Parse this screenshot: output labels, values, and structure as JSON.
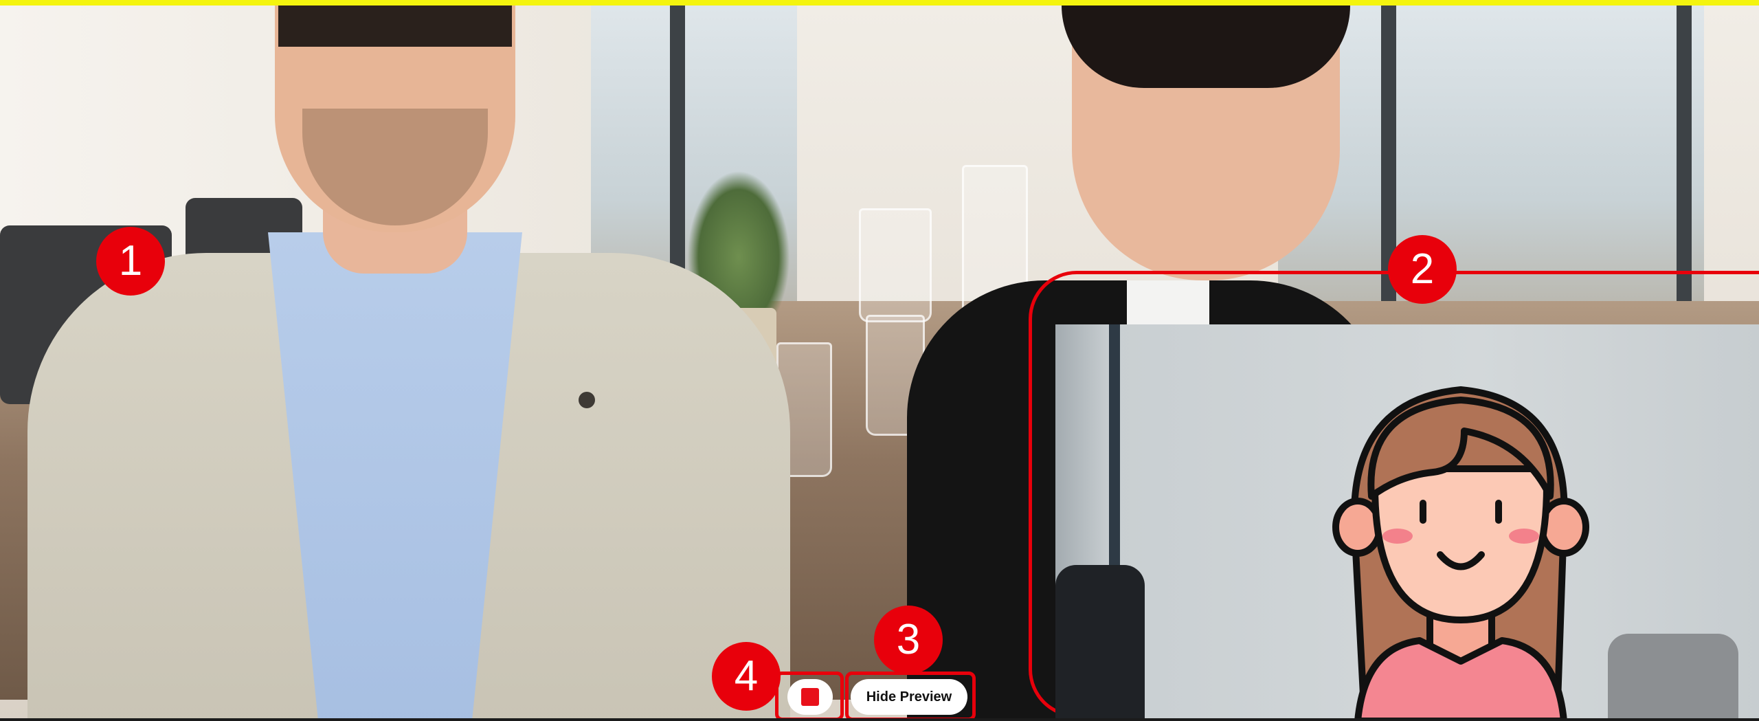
{
  "annotations": {
    "badge_1": "1",
    "badge_2": "2",
    "badge_3": "3",
    "badge_4": "4"
  },
  "controls": {
    "hide_preview_label": "Hide Preview",
    "stop_icon": "stop-square-icon",
    "stop_color": "#e8101a"
  },
  "highlight_color": "#e8000b",
  "top_bar_color": "#f4f40e",
  "preview": {
    "avatar_icon": "girl-avatar-icon"
  }
}
